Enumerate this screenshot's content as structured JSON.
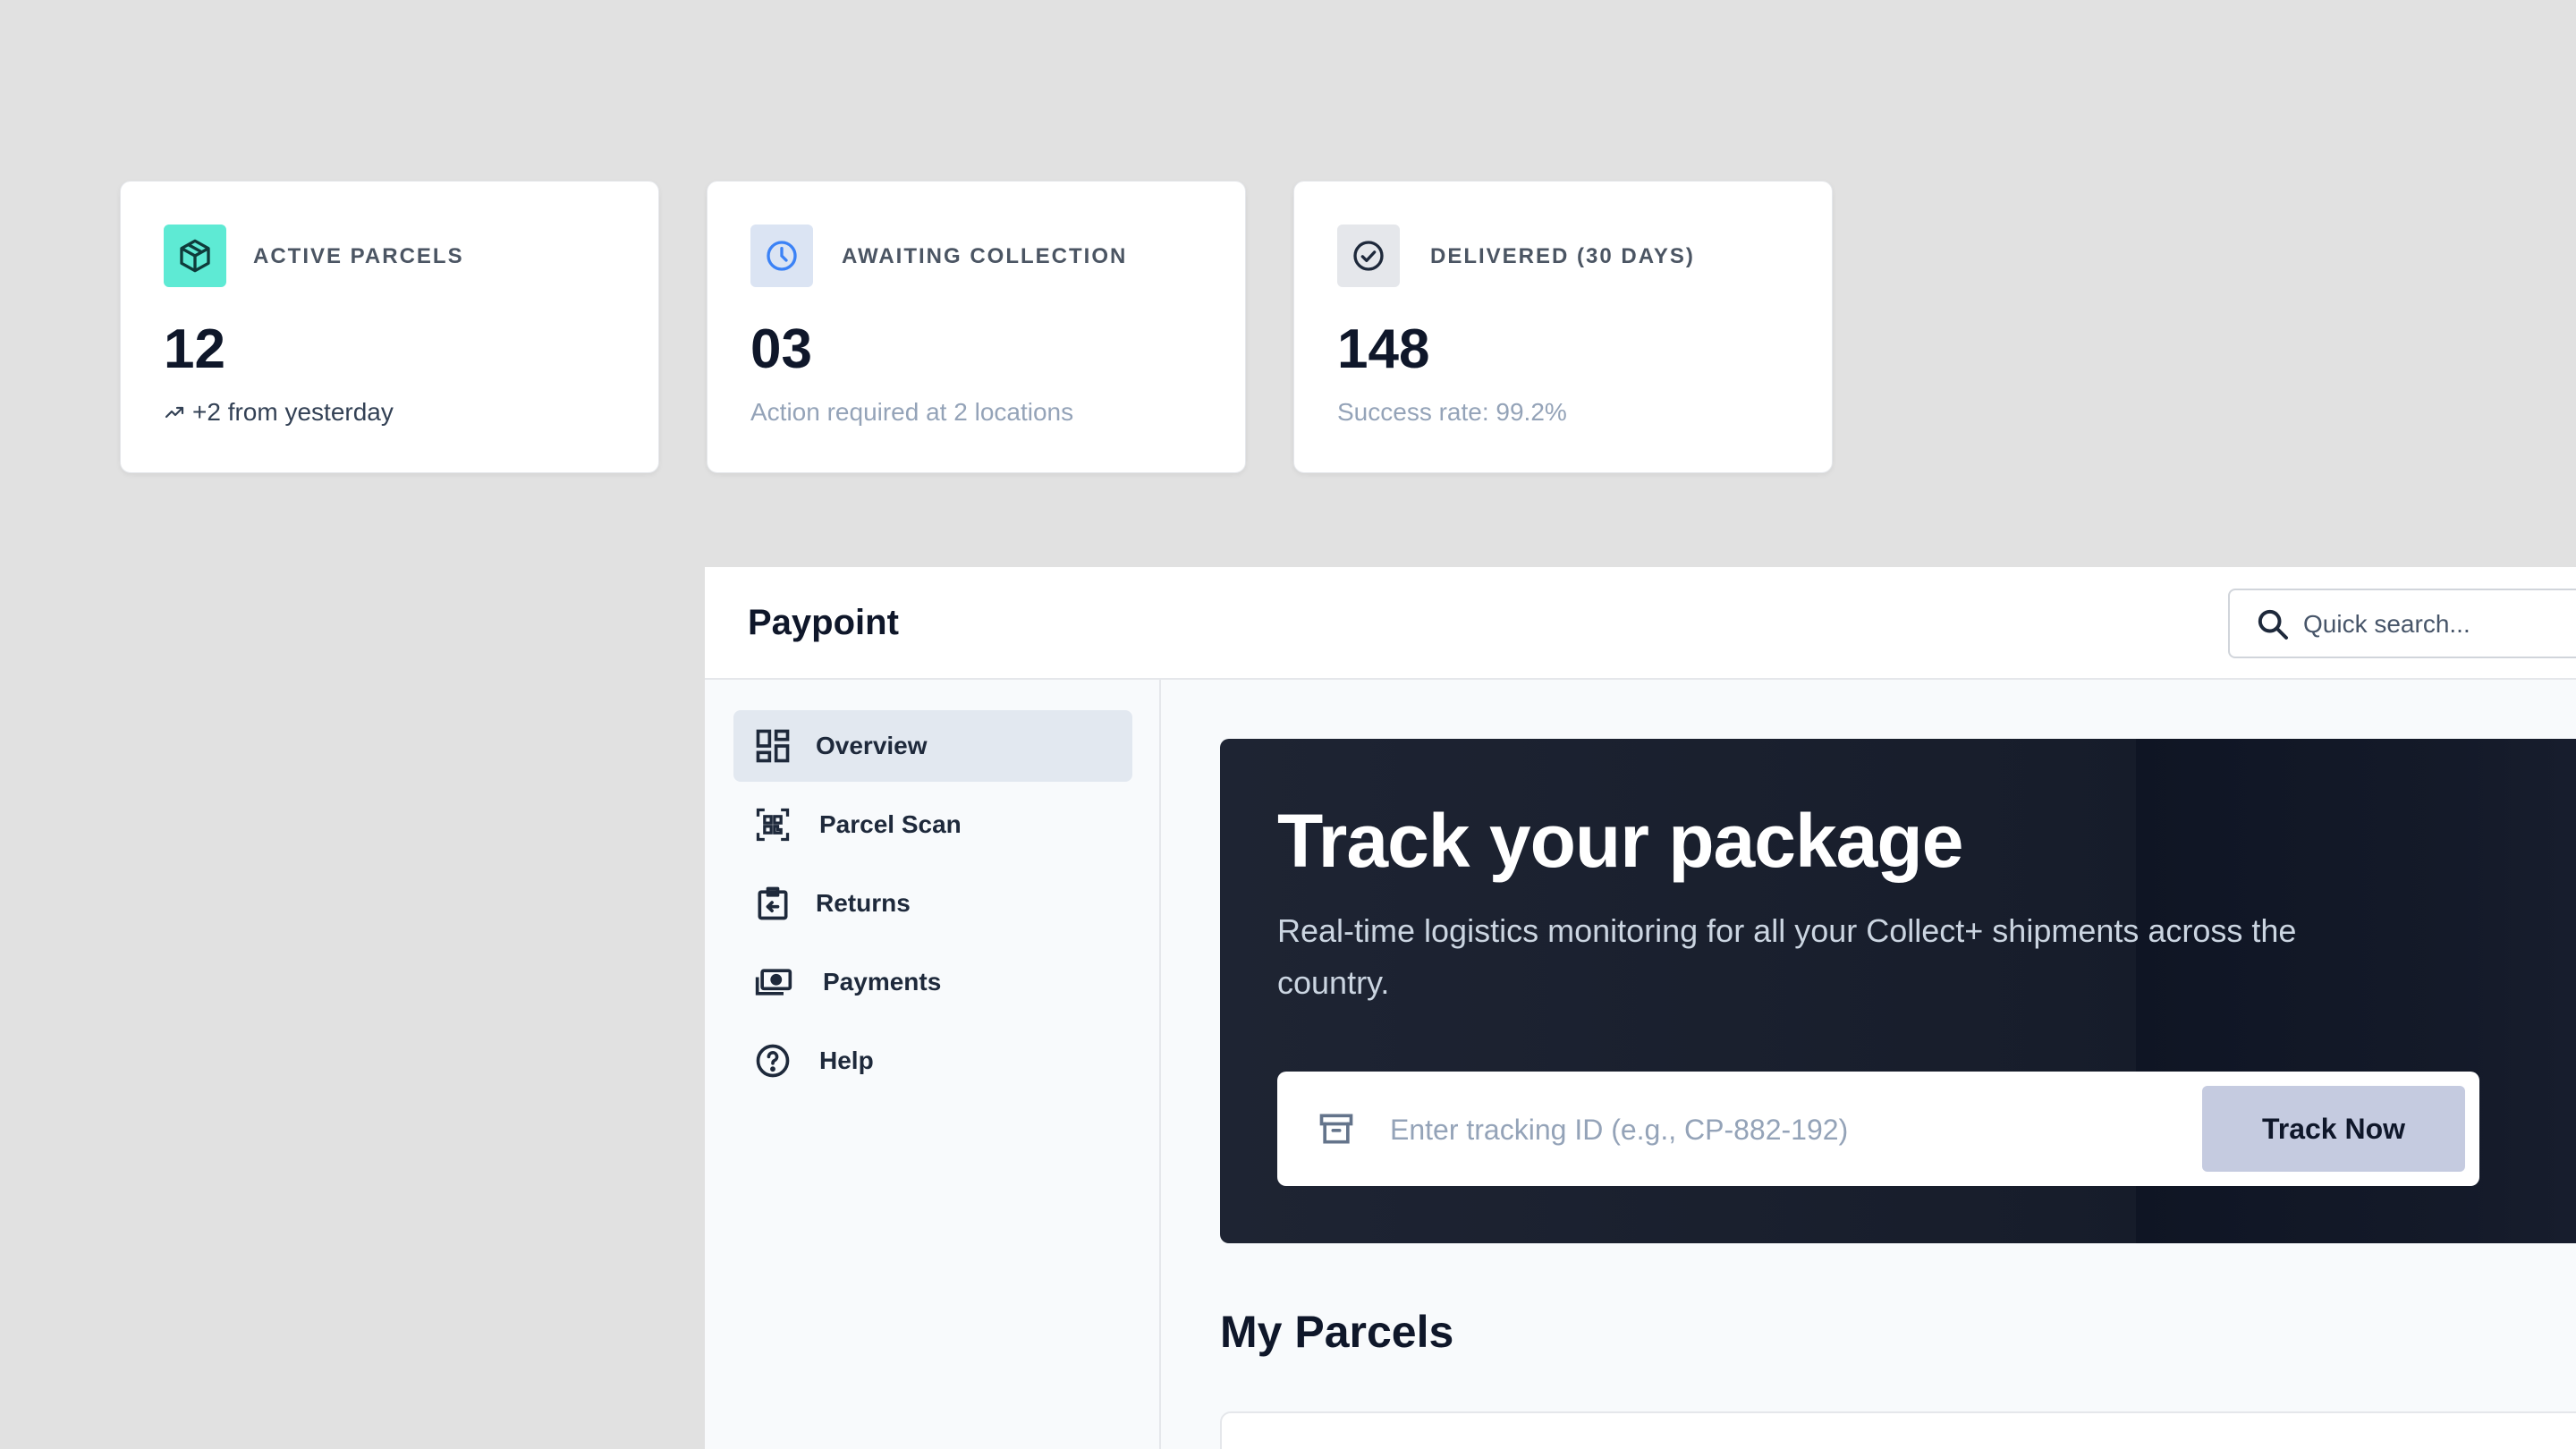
{
  "stats": [
    {
      "label": "ACTIVE PARCELS",
      "value": "12",
      "sub": "+2 from yesterday",
      "icon": "package-icon",
      "icon_bg": "#5eead4"
    },
    {
      "label": "AWAITING COLLECTION",
      "value": "03",
      "sub": "Action required at 2 locations",
      "icon": "clock-icon",
      "icon_bg": "#dbe4f3"
    },
    {
      "label": "DELIVERED (30 DAYS)",
      "value": "148",
      "sub": "Success rate: 99.2%",
      "icon": "check-circle-icon",
      "icon_bg": "#e5e7eb"
    }
  ],
  "app": {
    "brand": "Paypoint",
    "search": {
      "placeholder": "Quick search..."
    },
    "sidebar": {
      "items": [
        {
          "label": "Overview",
          "icon": "grid-icon",
          "active": true
        },
        {
          "label": "Parcel Scan",
          "icon": "qr-scan-icon",
          "active": false
        },
        {
          "label": "Returns",
          "icon": "return-clipboard-icon",
          "active": false
        },
        {
          "label": "Payments",
          "icon": "cash-icon",
          "active": false
        },
        {
          "label": "Help",
          "icon": "help-circle-icon",
          "active": false
        }
      ]
    },
    "hero": {
      "title": "Track your package",
      "description": "Real-time logistics monitoring for all your Collect+ shipments across the country.",
      "input_placeholder": "Enter tracking ID (e.g., CP-882-192)",
      "button_label": "Track Now"
    },
    "section_title": "My Parcels"
  },
  "colors": {
    "background": "#e1e1e1",
    "hero_bg": "#1a2030",
    "accent_button": "#c5cbe0",
    "active_nav": "#e2e8f0"
  }
}
